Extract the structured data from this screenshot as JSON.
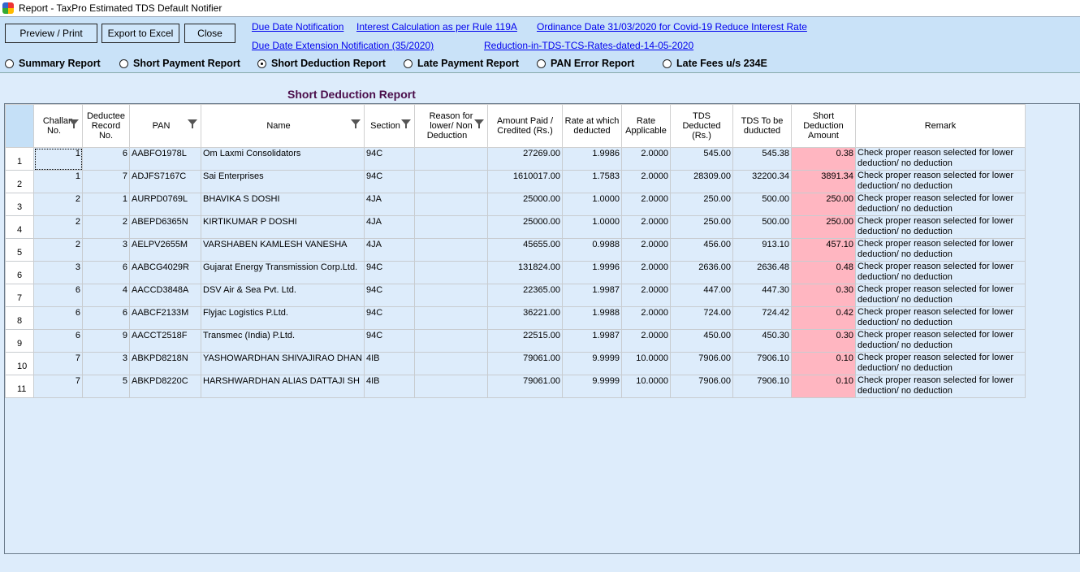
{
  "window": {
    "title": "Report - TaxPro Estimated TDS Default Notifier"
  },
  "toolbar": {
    "preview": "Preview / Print",
    "export": "Export to Excel",
    "close": "Close"
  },
  "links": [
    "Due Date Notification",
    "Interest Calculation as per Rule 119A",
    "Ordinance Date 31/03/2020 for Covid-19 Reduce Interest Rate",
    "Due Date Extension Notification (35/2020)",
    "Reduction-in-TDS-TCS-Rates-dated-14-05-2020"
  ],
  "report_types": [
    {
      "label": "Summary Report",
      "selected": false
    },
    {
      "label": "Short Payment Report",
      "selected": false
    },
    {
      "label": "Short Deduction Report",
      "selected": true
    },
    {
      "label": "Late Payment Report",
      "selected": false
    },
    {
      "label": "PAN Error Report",
      "selected": false
    },
    {
      "label": "Late Fees u/s 234E",
      "selected": false
    }
  ],
  "report_title": "Short Deduction Report",
  "colors": {
    "short_deduction_highlight": "#ffb6c1",
    "panel": "#c9e2f8",
    "link": "#0000ee"
  },
  "table": {
    "columns": [
      "Challan No.",
      "Deductee Record No.",
      "PAN",
      "Name",
      "Section",
      "Reason for lower/ Non Deduction",
      "Amount Paid / Credited (Rs.)",
      "Rate at which deducted",
      "Rate Applicable",
      "TDS Deducted (Rs.)",
      "TDS To be duducted",
      "Short Deduction Amount",
      "Remark"
    ],
    "rows": [
      [
        "1",
        "1",
        "6",
        "AABFO1978L",
        "Om Laxmi Consolidators",
        "94C",
        "",
        "27269.00",
        "1.9986",
        "2.0000",
        "545.00",
        "545.38",
        "0.38",
        "Check proper reason selected for lower deduction/ no deduction"
      ],
      [
        "2",
        "1",
        "7",
        "ADJFS7167C",
        "Sai Enterprises",
        "94C",
        "",
        "1610017.00",
        "1.7583",
        "2.0000",
        "28309.00",
        "32200.34",
        "3891.34",
        "Check proper reason selected for lower deduction/ no deduction"
      ],
      [
        "3",
        "2",
        "1",
        "AURPD0769L",
        "BHAVIKA S DOSHI",
        "4JA",
        "",
        "25000.00",
        "1.0000",
        "2.0000",
        "250.00",
        "500.00",
        "250.00",
        "Check proper reason selected for lower deduction/ no deduction"
      ],
      [
        "4",
        "2",
        "2",
        "ABEPD6365N",
        "KIRTIKUMAR P DOSHI",
        "4JA",
        "",
        "25000.00",
        "1.0000",
        "2.0000",
        "250.00",
        "500.00",
        "250.00",
        "Check proper reason selected for lower deduction/ no deduction"
      ],
      [
        "5",
        "2",
        "3",
        "AELPV2655M",
        "VARSHABEN KAMLESH VANESHA",
        "4JA",
        "",
        "45655.00",
        "0.9988",
        "2.0000",
        "456.00",
        "913.10",
        "457.10",
        "Check proper reason selected for lower deduction/ no deduction"
      ],
      [
        "6",
        "3",
        "6",
        "AABCG4029R",
        "Gujarat Energy Transmission Corp.Ltd.",
        "94C",
        "",
        "131824.00",
        "1.9996",
        "2.0000",
        "2636.00",
        "2636.48",
        "0.48",
        "Check proper reason selected for lower deduction/ no deduction"
      ],
      [
        "7",
        "6",
        "4",
        "AACCD3848A",
        "DSV Air & Sea Pvt. Ltd.",
        "94C",
        "",
        "22365.00",
        "1.9987",
        "2.0000",
        "447.00",
        "447.30",
        "0.30",
        "Check proper reason selected for lower deduction/ no deduction"
      ],
      [
        "8",
        "6",
        "6",
        "AABCF2133M",
        "Flyjac Logistics P.Ltd.",
        "94C",
        "",
        "36221.00",
        "1.9988",
        "2.0000",
        "724.00",
        "724.42",
        "0.42",
        "Check proper reason selected for lower deduction/ no deduction"
      ],
      [
        "9",
        "6",
        "9",
        "AACCT2518F",
        "Transmec (India) P.Ltd.",
        "94C",
        "",
        "22515.00",
        "1.9987",
        "2.0000",
        "450.00",
        "450.30",
        "0.30",
        "Check proper reason selected for lower deduction/ no deduction"
      ],
      [
        "10",
        "7",
        "3",
        "ABKPD8218N",
        "YASHOWARDHAN SHIVAJIRAO DHAN",
        "4IB",
        "",
        "79061.00",
        "9.9999",
        "10.0000",
        "7906.00",
        "7906.10",
        "0.10",
        "Check proper reason selected for lower deduction/ no deduction"
      ],
      [
        "11",
        "7",
        "5",
        "ABKPD8220C",
        "HARSHWARDHAN ALIAS DATTAJI SH",
        "4IB",
        "",
        "79061.00",
        "9.9999",
        "10.0000",
        "7906.00",
        "7906.10",
        "0.10",
        "Check proper reason selected for lower deduction/ no deduction"
      ]
    ]
  }
}
